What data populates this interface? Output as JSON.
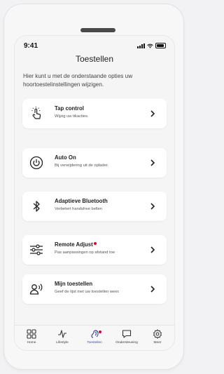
{
  "status": {
    "time": "9:41"
  },
  "header": {
    "title": "Toestellen"
  },
  "intro": "Hier kunt u met de onderstaande opties uw hoortoestelinstellingen wijzigen.",
  "cards": [
    {
      "title": "Tap control",
      "subtitle": "Wijzig uw tikacties.",
      "icon": "tap-icon"
    },
    {
      "title": "Auto On",
      "subtitle": "Bij verwijdering uit de oplader.",
      "icon": "power-icon"
    },
    {
      "title": "Adaptieve Bluetooth",
      "subtitle": "Verbetert handsfree bellen",
      "icon": "bluetooth-icon"
    },
    {
      "title": "Remote Adjust",
      "subtitle": "Pas aanpassingen op afstand toe",
      "icon": "sliders-icon",
      "badge": true
    },
    {
      "title": "Mijn toestellen",
      "subtitle": "Geef de lijst met uw toestellen weer.",
      "icon": "person-audio-icon"
    }
  ],
  "nav": [
    {
      "label": "Home",
      "icon": "grid-icon"
    },
    {
      "label": "Lifestyle",
      "icon": "pulse-icon"
    },
    {
      "label": "Toestellen",
      "icon": "hearing-aid-icon",
      "active": true,
      "badge": true
    },
    {
      "label": "Ondersteuning",
      "icon": "chat-icon"
    },
    {
      "label": "Meer",
      "icon": "gear-icon"
    }
  ],
  "colors": {
    "accent": "#3a4a9c",
    "badge": "#e3002b",
    "background": "#f5f5f6"
  }
}
